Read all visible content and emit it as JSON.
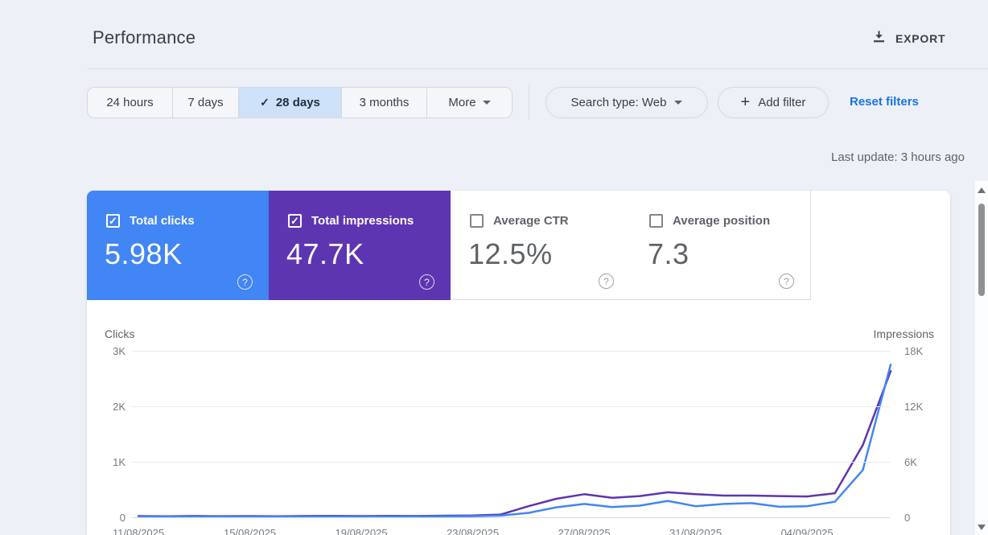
{
  "colors": {
    "clicks_blue": "#4285f4",
    "impressions_purple": "#5e35b1",
    "link_blue": "#1a73e8",
    "selected_chip_bg": "#cde2f8"
  },
  "header": {
    "title": "Performance",
    "export_label": "EXPORT"
  },
  "filter_bar": {
    "date_ranges": [
      {
        "label": "24 hours",
        "selected": false
      },
      {
        "label": "7 days",
        "selected": false
      },
      {
        "label": "28 days",
        "selected": true
      },
      {
        "label": "3 months",
        "selected": false
      },
      {
        "label": "More",
        "selected": false,
        "dropdown": true
      }
    ],
    "search_type_label": "Search type: Web",
    "add_filter_label": "Add filter",
    "reset_filters_label": "Reset filters"
  },
  "status": {
    "last_update": "Last update: 3 hours ago"
  },
  "metric_cards": [
    {
      "label": "Total clicks",
      "value": "5.98K",
      "checked": true,
      "color": "#4285f4"
    },
    {
      "label": "Total impressions",
      "value": "47.7K",
      "checked": true,
      "color": "#5e35b1"
    },
    {
      "label": "Average CTR",
      "value": "12.5%",
      "checked": false,
      "color": "#ffffff"
    },
    {
      "label": "Average position",
      "value": "7.3",
      "checked": false,
      "color": "#ffffff"
    }
  ],
  "chart_data": {
    "type": "line",
    "title": "",
    "grid": true,
    "legend_position": "none",
    "left_axis": {
      "label": "Clicks",
      "ticks": [
        "3K",
        "2K",
        "1K",
        "0"
      ],
      "max": 3000
    },
    "right_axis": {
      "label": "Impressions",
      "ticks": [
        "18K",
        "12K",
        "6K",
        "0"
      ],
      "max": 18000
    },
    "x_tick_labels": [
      "11/08/2025",
      "15/08/2025",
      "19/08/2025",
      "23/08/2025",
      "27/08/2025",
      "31/08/2025",
      "04/09/2025"
    ],
    "dates": [
      "11/08/2025",
      "12/08/2025",
      "13/08/2025",
      "14/08/2025",
      "15/08/2025",
      "16/08/2025",
      "17/08/2025",
      "18/08/2025",
      "19/08/2025",
      "20/08/2025",
      "21/08/2025",
      "22/08/2025",
      "23/08/2025",
      "24/08/2025",
      "25/08/2025",
      "26/08/2025",
      "27/08/2025",
      "28/08/2025",
      "29/08/2025",
      "30/08/2025",
      "31/08/2025",
      "01/09/2025",
      "02/09/2025",
      "03/09/2025",
      "04/09/2025",
      "05/09/2025",
      "06/09/2025",
      "07/09/2025"
    ],
    "series": [
      {
        "name": "Total clicks",
        "axis": "left",
        "color": "#4285f4",
        "values": [
          12,
          10,
          13,
          11,
          12,
          10,
          13,
          15,
          12,
          15,
          14,
          18,
          20,
          30,
          80,
          180,
          240,
          185,
          210,
          295,
          200,
          240,
          255,
          190,
          200,
          280,
          850,
          2750
        ]
      },
      {
        "name": "Total impressions",
        "axis": "right",
        "color": "#5e35b1",
        "values": [
          130,
          110,
          140,
          120,
          130,
          110,
          140,
          150,
          130,
          150,
          140,
          170,
          200,
          300,
          1200,
          2000,
          2500,
          2100,
          2300,
          2700,
          2500,
          2350,
          2350,
          2300,
          2250,
          2600,
          7800,
          15800
        ]
      }
    ]
  }
}
